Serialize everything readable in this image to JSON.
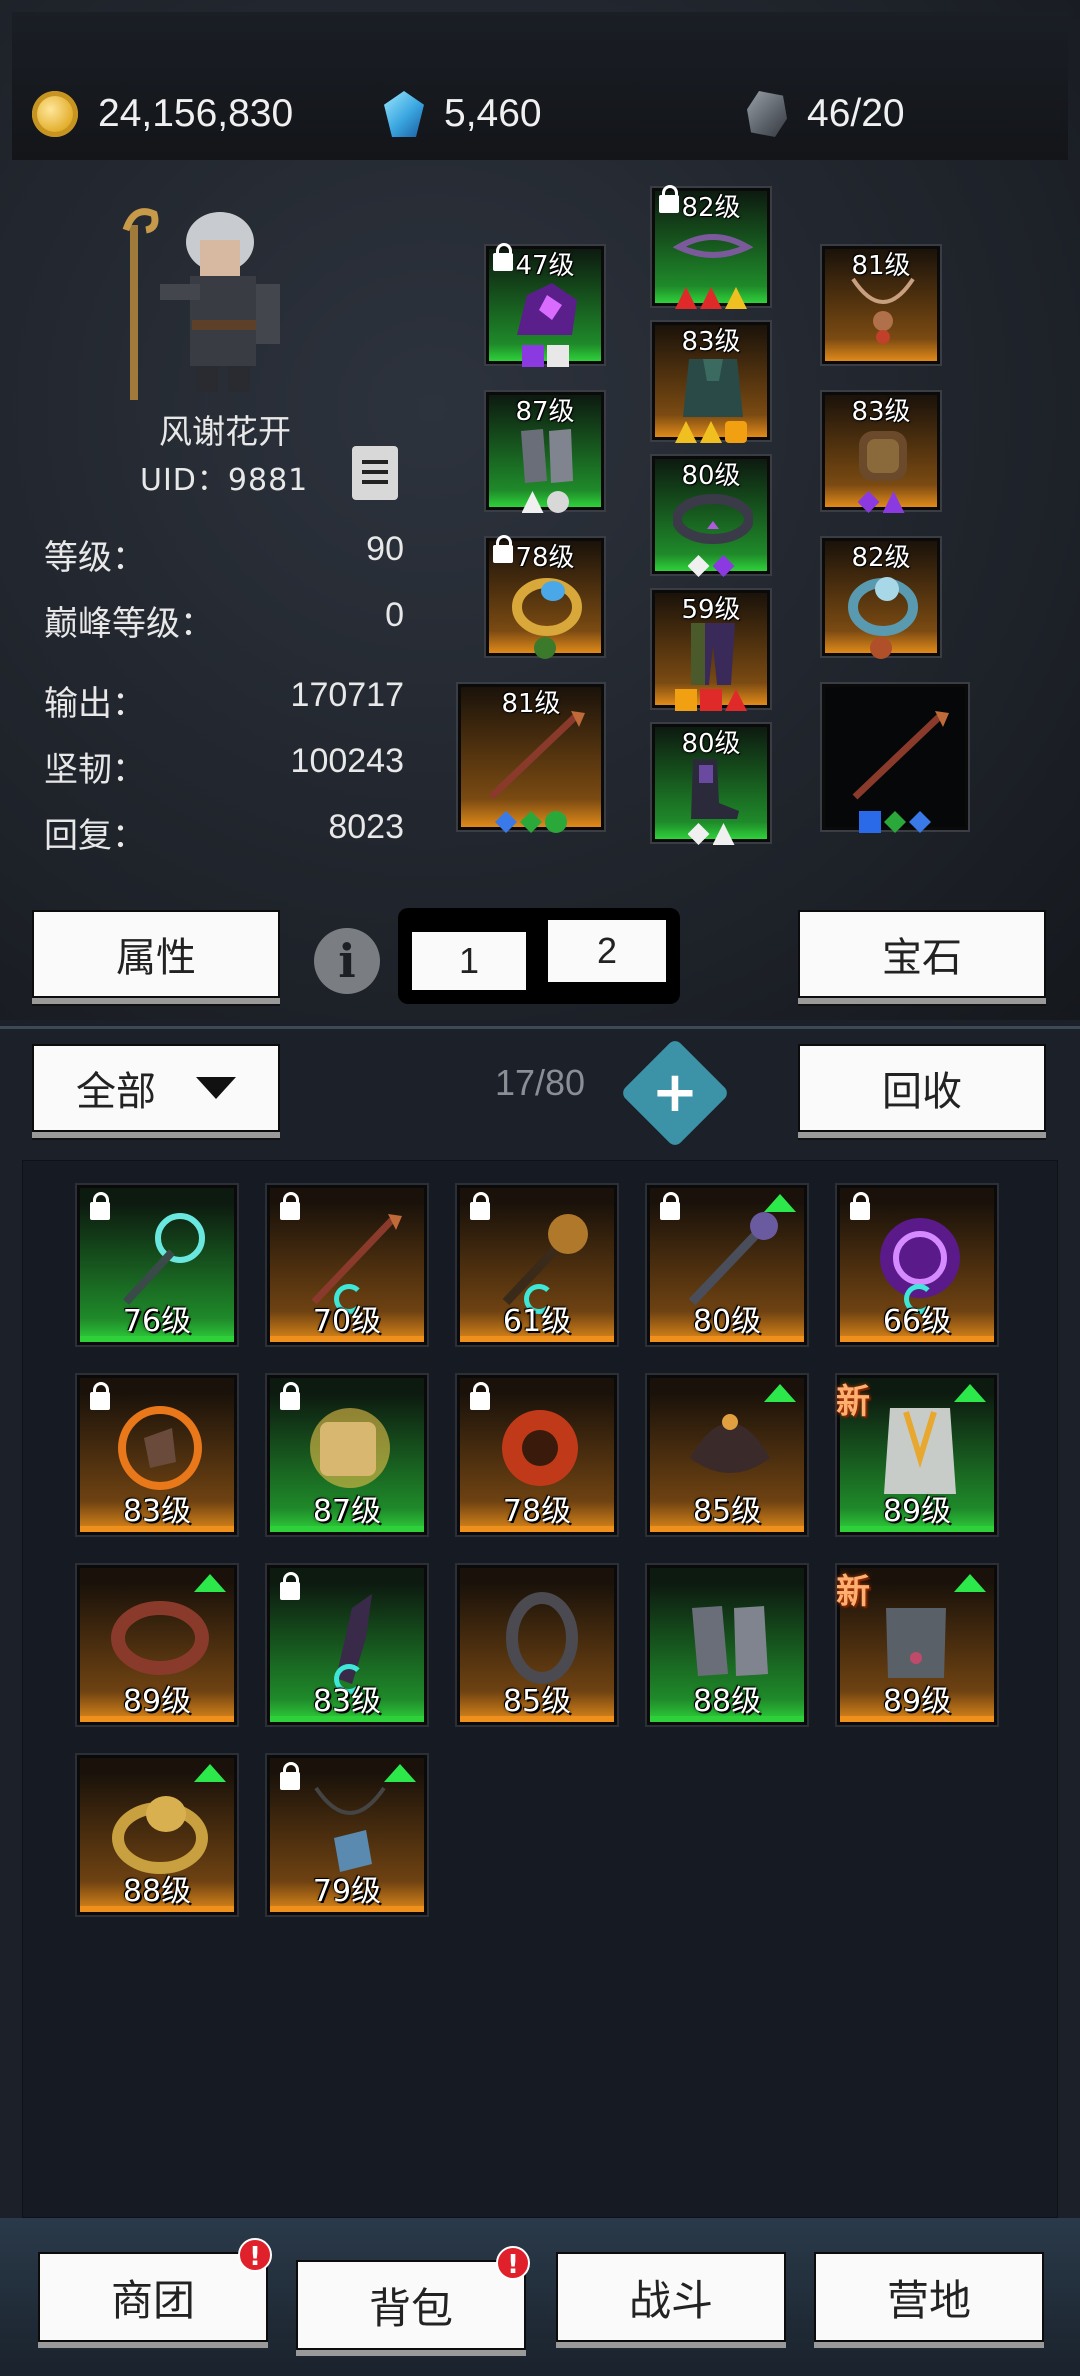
{
  "currency": {
    "gold": "24,156,830",
    "diamond": "5,460",
    "stone": "46/20"
  },
  "character": {
    "name": "风谢花开",
    "uid": "UID：9881"
  },
  "stats": [
    {
      "label": "等级：",
      "value": "90"
    },
    {
      "label": "巅峰等级：",
      "value": "0"
    },
    {
      "label": "输出：",
      "value": "170717"
    },
    {
      "label": "坚韧：",
      "value": "100243"
    },
    {
      "label": "回复：",
      "value": "8023"
    }
  ],
  "equipment": {
    "helmet_left": "47级",
    "crown": "82级",
    "necklace": "81级",
    "gloves": "87级",
    "armor": "83级",
    "bracer": "83级",
    "ring_left": "78级",
    "belt": "80级",
    "ring_right": "82级",
    "weapon": "81级",
    "pants": "59级",
    "boots": "80级"
  },
  "buttons": {
    "attributes": "属性",
    "info": "i",
    "tab1": "1",
    "tab2": "2",
    "gems": "宝石",
    "filter": "全部",
    "bag_count": "17/80",
    "recycle": "回收",
    "expand": "+"
  },
  "bag_items": [
    {
      "level": "76级",
      "rarity": "green",
      "locked": true,
      "up": false,
      "new": false
    },
    {
      "level": "70级",
      "rarity": "orange",
      "locked": true,
      "up": false,
      "new": false
    },
    {
      "level": "61级",
      "rarity": "orange",
      "locked": true,
      "up": false,
      "new": false
    },
    {
      "level": "80级",
      "rarity": "orange",
      "locked": true,
      "up": true,
      "new": false
    },
    {
      "level": "66级",
      "rarity": "orange",
      "locked": true,
      "up": false,
      "new": false
    },
    {
      "level": "83级",
      "rarity": "orange",
      "locked": true,
      "up": false,
      "new": false
    },
    {
      "level": "87级",
      "rarity": "green",
      "locked": true,
      "up": false,
      "new": false
    },
    {
      "level": "78级",
      "rarity": "orange",
      "locked": true,
      "up": false,
      "new": false
    },
    {
      "level": "85级",
      "rarity": "orange",
      "locked": false,
      "up": true,
      "new": false
    },
    {
      "level": "89级",
      "rarity": "green",
      "locked": false,
      "up": true,
      "new": true
    },
    {
      "level": "89级",
      "rarity": "orange",
      "locked": false,
      "up": true,
      "new": false
    },
    {
      "level": "83级",
      "rarity": "green",
      "locked": true,
      "up": false,
      "new": false
    },
    {
      "level": "85级",
      "rarity": "orange",
      "locked": false,
      "up": false,
      "new": false
    },
    {
      "level": "88级",
      "rarity": "green",
      "locked": false,
      "up": false,
      "new": false
    },
    {
      "level": "89级",
      "rarity": "orange",
      "locked": false,
      "up": true,
      "new": true
    },
    {
      "level": "88级",
      "rarity": "orange",
      "locked": false,
      "up": true,
      "new": false
    },
    {
      "level": "79级",
      "rarity": "orange",
      "locked": true,
      "up": true,
      "new": false
    }
  ],
  "new_label": "新",
  "nav": [
    {
      "label": "商团",
      "badge": "!"
    },
    {
      "label": "背包",
      "badge": "!"
    },
    {
      "label": "战斗",
      "badge": ""
    },
    {
      "label": "营地",
      "badge": ""
    }
  ]
}
